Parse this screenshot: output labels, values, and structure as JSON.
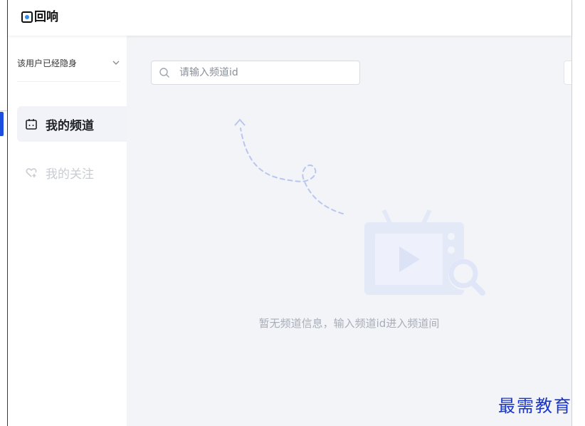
{
  "app": {
    "logo_text": "回响"
  },
  "sidebar": {
    "status_text": "该用户已经隐身",
    "items": [
      {
        "label": "我的频道",
        "icon": "calendar-icon",
        "active": true
      },
      {
        "label": "我的关注",
        "icon": "heart-plus-icon",
        "active": false
      }
    ]
  },
  "search": {
    "placeholder": "请输入频道id",
    "value": ""
  },
  "empty_state": {
    "message": "暂无频道信息，输入频道id进入频道间"
  },
  "watermark": "最需教育",
  "colors": {
    "accent": "#1c4fe0",
    "main_bg": "#f3f4f8",
    "illustration": "#e4e9f8",
    "dash": "#b9c6ef"
  }
}
